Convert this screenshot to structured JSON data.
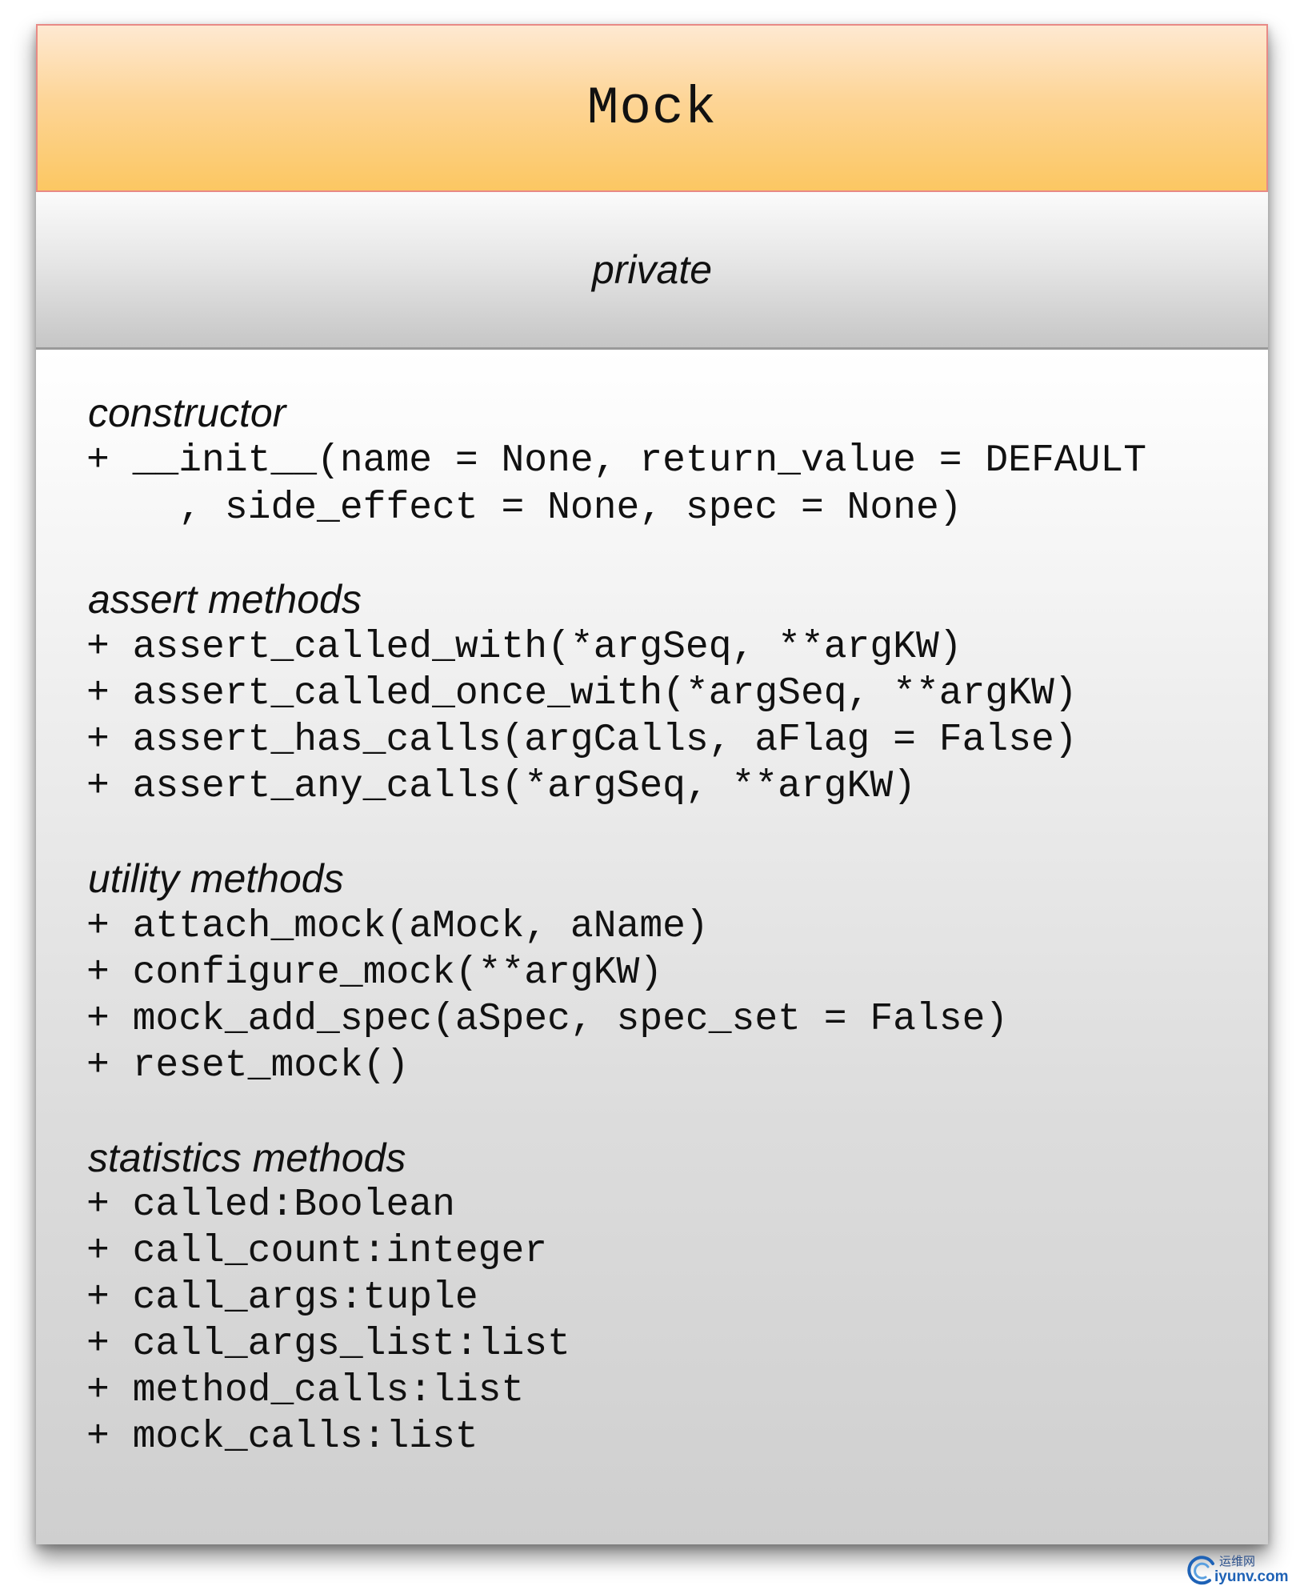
{
  "class_name": "Mock",
  "visibility_section": "private",
  "sections": [
    {
      "title": "constructor",
      "lines": [
        "+ __init__(name = None, return_value = DEFAULT",
        "    , side_effect = None, spec = None)"
      ]
    },
    {
      "title": "assert methods",
      "lines": [
        "+ assert_called_with(*argSeq, **argKW)",
        "+ assert_called_once_with(*argSeq, **argKW)",
        "+ assert_has_calls(argCalls, aFlag = False)",
        "+ assert_any_calls(*argSeq, **argKW)"
      ]
    },
    {
      "title": "utility methods",
      "lines": [
        "+ attach_mock(aMock, aName)",
        "+ configure_mock(**argKW)",
        "+ mock_add_spec(aSpec, spec_set = False)",
        "+ reset_mock()"
      ]
    },
    {
      "title": "statistics methods",
      "lines": [
        "+ called:Boolean",
        "+ call_count:integer",
        "+ call_args:tuple",
        "+ call_args_list:list",
        "+ method_calls:list",
        "+ mock_calls:list"
      ]
    }
  ],
  "watermark": {
    "cn": "运维网",
    "en": "iyunv.com",
    "logo_icon": "swirl-logo-icon"
  },
  "colors": {
    "title_top": "#fee9d2",
    "title_bottom": "#fcc762",
    "title_border": "#e88a86"
  }
}
